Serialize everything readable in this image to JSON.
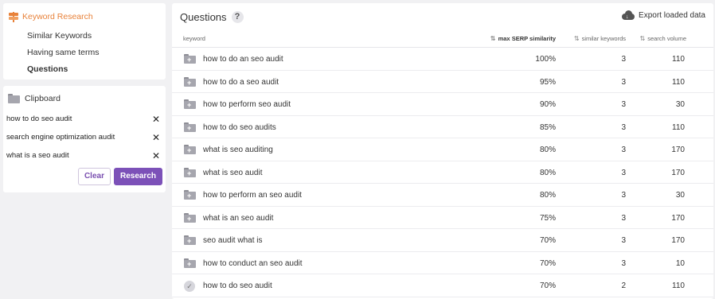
{
  "sidebar": {
    "section_title": "Keyword Research",
    "section_icon": "signpost-icon",
    "accent_color": "#e8823a",
    "items": [
      {
        "label": "Similar Keywords",
        "active": false
      },
      {
        "label": "Having same terms",
        "active": false
      },
      {
        "label": "Questions",
        "active": true
      }
    ]
  },
  "clipboard": {
    "title": "Clipboard",
    "icon": "folder-icon",
    "items": [
      "how to do seo audit",
      "search engine optimization audit",
      "what is a seo audit"
    ],
    "clear_label": "Clear",
    "research_label": "Research",
    "primary_color": "#7c51b8"
  },
  "main": {
    "title": "Questions",
    "help_label": "?",
    "export_label": "Export loaded data",
    "columns": {
      "keyword": "keyword",
      "similarity": "max SERP similarity",
      "similar_keywords": "similar keywords",
      "search_volume": "search volume"
    },
    "rows": [
      {
        "keyword": "how to do an seo audit",
        "similarity": "100%",
        "similar": "3",
        "volume": "110",
        "icon": "folder-add-icon"
      },
      {
        "keyword": "how to do a seo audit",
        "similarity": "95%",
        "similar": "3",
        "volume": "110",
        "icon": "folder-add-icon"
      },
      {
        "keyword": "how to perform seo audit",
        "similarity": "90%",
        "similar": "3",
        "volume": "30",
        "icon": "folder-add-icon"
      },
      {
        "keyword": "how to do seo audits",
        "similarity": "85%",
        "similar": "3",
        "volume": "110",
        "icon": "folder-add-icon"
      },
      {
        "keyword": "what is seo auditing",
        "similarity": "80%",
        "similar": "3",
        "volume": "170",
        "icon": "folder-add-icon"
      },
      {
        "keyword": "what is seo audit",
        "similarity": "80%",
        "similar": "3",
        "volume": "170",
        "icon": "folder-add-icon"
      },
      {
        "keyword": "how to perform an seo audit",
        "similarity": "80%",
        "similar": "3",
        "volume": "30",
        "icon": "folder-add-icon"
      },
      {
        "keyword": "what is an seo audit",
        "similarity": "75%",
        "similar": "3",
        "volume": "170",
        "icon": "folder-add-icon"
      },
      {
        "keyword": "seo audit what is",
        "similarity": "70%",
        "similar": "3",
        "volume": "170",
        "icon": "folder-add-icon"
      },
      {
        "keyword": "how to conduct an seo audit",
        "similarity": "70%",
        "similar": "3",
        "volume": "10",
        "icon": "folder-add-icon"
      },
      {
        "keyword": "how to do seo audit",
        "similarity": "70%",
        "similar": "2",
        "volume": "110",
        "icon": "check-icon"
      }
    ]
  }
}
